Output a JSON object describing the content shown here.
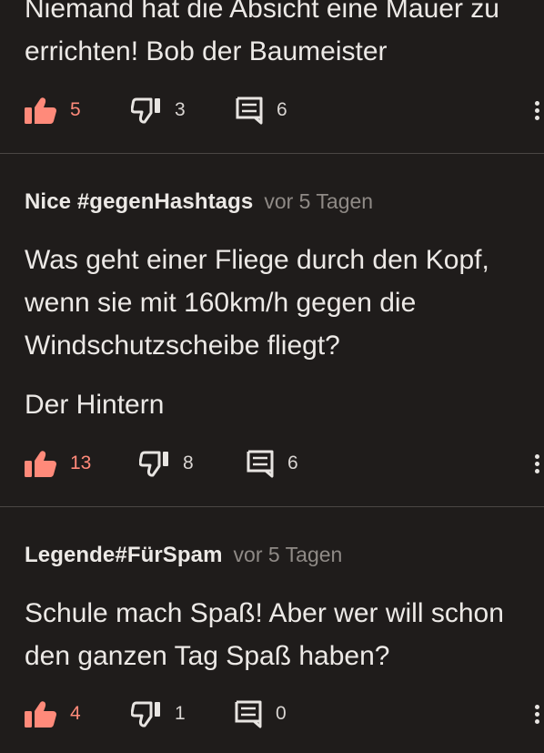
{
  "comments": [
    {
      "author": "",
      "time": "",
      "lines": [
        "Niemand hat die Absicht eine Mauer zu\nerrichten! Bob der Baumeister"
      ],
      "likes": "5",
      "dislikes": "3",
      "replies": "6"
    },
    {
      "author": "Nice #gegenHashtags",
      "time": "vor 5 Tagen",
      "lines": [
        "Was geht einer Fliege durch den Kopf,\nwenn sie mit 160km/h gegen die\nWindschutzscheibe fliegt?",
        "Der Hintern"
      ],
      "likes": "13",
      "dislikes": "8",
      "replies": "6"
    },
    {
      "author": "Legende#FürSpam",
      "time": "vor 5 Tagen",
      "lines": [
        "Schule mach Spaß! Aber wer will schon\nden ganzen Tag Spaß haben?"
      ],
      "likes": "4",
      "dislikes": "1",
      "replies": "0"
    }
  ],
  "icons": {
    "like": "thumbs-up-icon",
    "dislike": "thumbs-down-icon",
    "reply": "comment-icon",
    "more": "more-vertical-icon"
  },
  "colors": {
    "background": "#1f1c1b",
    "like_accent": "#ff8a7a",
    "text": "#ece9e6",
    "muted": "#8f8a86"
  }
}
